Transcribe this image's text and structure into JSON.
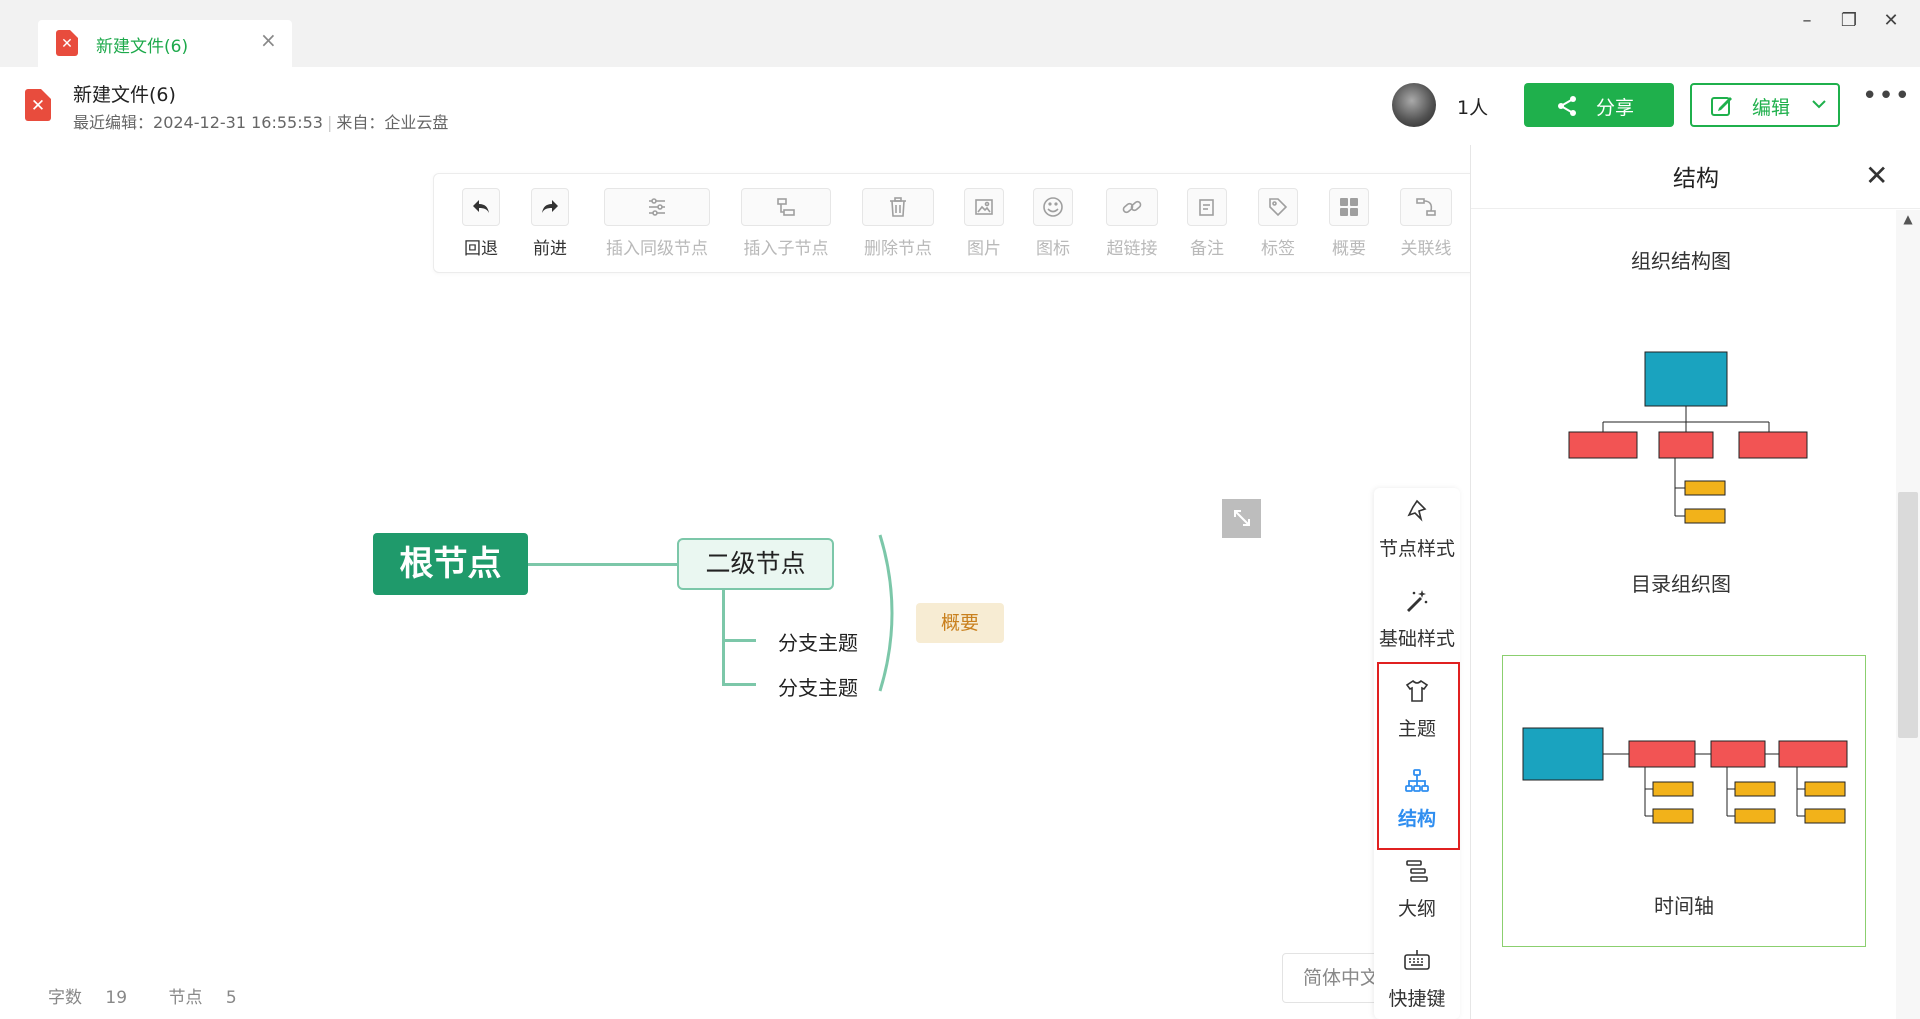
{
  "tab": {
    "title": "新建文件(6)",
    "close": "×"
  },
  "window": {
    "minimize": "–",
    "restore": "❐",
    "close": "✕"
  },
  "header": {
    "file_name": "新建文件(6)",
    "edited_label": "最近编辑：",
    "edited_time": "2024-12-31 16:55:53",
    "source_label": "来自：",
    "source": "企业云盘",
    "people_count": "1人",
    "share_label": "分享",
    "edit_label": "编辑",
    "more": "•••"
  },
  "toolbar": [
    {
      "label": "回退",
      "icon": "undo-icon",
      "enabled": true
    },
    {
      "label": "前进",
      "icon": "redo-icon",
      "enabled": true
    },
    {
      "label": "插入同级节点",
      "icon": "insert-sibling-icon",
      "enabled": false
    },
    {
      "label": "插入子节点",
      "icon": "insert-child-icon",
      "enabled": false
    },
    {
      "label": "删除节点",
      "icon": "trash-icon",
      "enabled": false
    },
    {
      "label": "图片",
      "icon": "image-icon",
      "enabled": false
    },
    {
      "label": "图标",
      "icon": "smiley-icon",
      "enabled": false
    },
    {
      "label": "超链接",
      "icon": "link-icon",
      "enabled": false
    },
    {
      "label": "备注",
      "icon": "note-icon",
      "enabled": false
    },
    {
      "label": "标签",
      "icon": "tag-icon",
      "enabled": false
    },
    {
      "label": "概要",
      "icon": "summary-grid-icon",
      "enabled": false
    },
    {
      "label": "关联线",
      "icon": "relation-line-icon",
      "enabled": false
    }
  ],
  "mindmap": {
    "root": "根节点",
    "level2": "二级节点",
    "branches": [
      "分支主题",
      "分支主题"
    ],
    "summary": "概要"
  },
  "status": {
    "words_label": "字数",
    "words": "19",
    "nodes_label": "节点",
    "nodes": "5"
  },
  "language": "简体中文",
  "side_rail": [
    {
      "label": "节点样式",
      "icon": "node-style-icon"
    },
    {
      "label": "基础样式",
      "icon": "magic-wand-icon"
    },
    {
      "label": "主题",
      "icon": "shirt-icon"
    },
    {
      "label": "结构",
      "icon": "structure-icon",
      "active": true
    },
    {
      "label": "大纲",
      "icon": "outline-icon"
    },
    {
      "label": "快捷键",
      "icon": "keyboard-icon"
    }
  ],
  "panel": {
    "title": "结构",
    "structures": [
      {
        "label": "组织结构图"
      },
      {
        "label": "目录组织图"
      },
      {
        "label": "时间轴",
        "selected": true
      }
    ]
  },
  "colors": {
    "brand_green": "#1fb04c",
    "root_node": "#1f9a6b",
    "branch_line": "#7cc7a9",
    "active_blue": "#2f8ef0",
    "summary_text": "#c9801e",
    "diagram_blue": "#1aa3bf",
    "diagram_red": "#f25454",
    "diagram_yellow": "#f2b21a",
    "highlight_red": "#e02020"
  }
}
